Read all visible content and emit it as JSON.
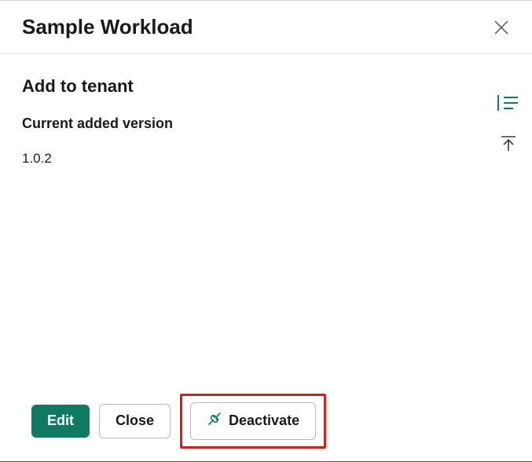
{
  "header": {
    "title": "Sample Workload"
  },
  "panel": {
    "section_title": "Add to tenant",
    "version_label": "Current added version",
    "version_value": "1.0.2"
  },
  "buttons": {
    "edit": "Edit",
    "close": "Close",
    "deactivate": "Deactivate"
  },
  "icons": {
    "close_x": "close-icon",
    "list": "list-icon",
    "scroll_top": "scroll-top-icon",
    "plug": "plug-disconnected-icon"
  },
  "colors": {
    "primary": "#0f7a61",
    "highlight_box": "#e11919"
  }
}
